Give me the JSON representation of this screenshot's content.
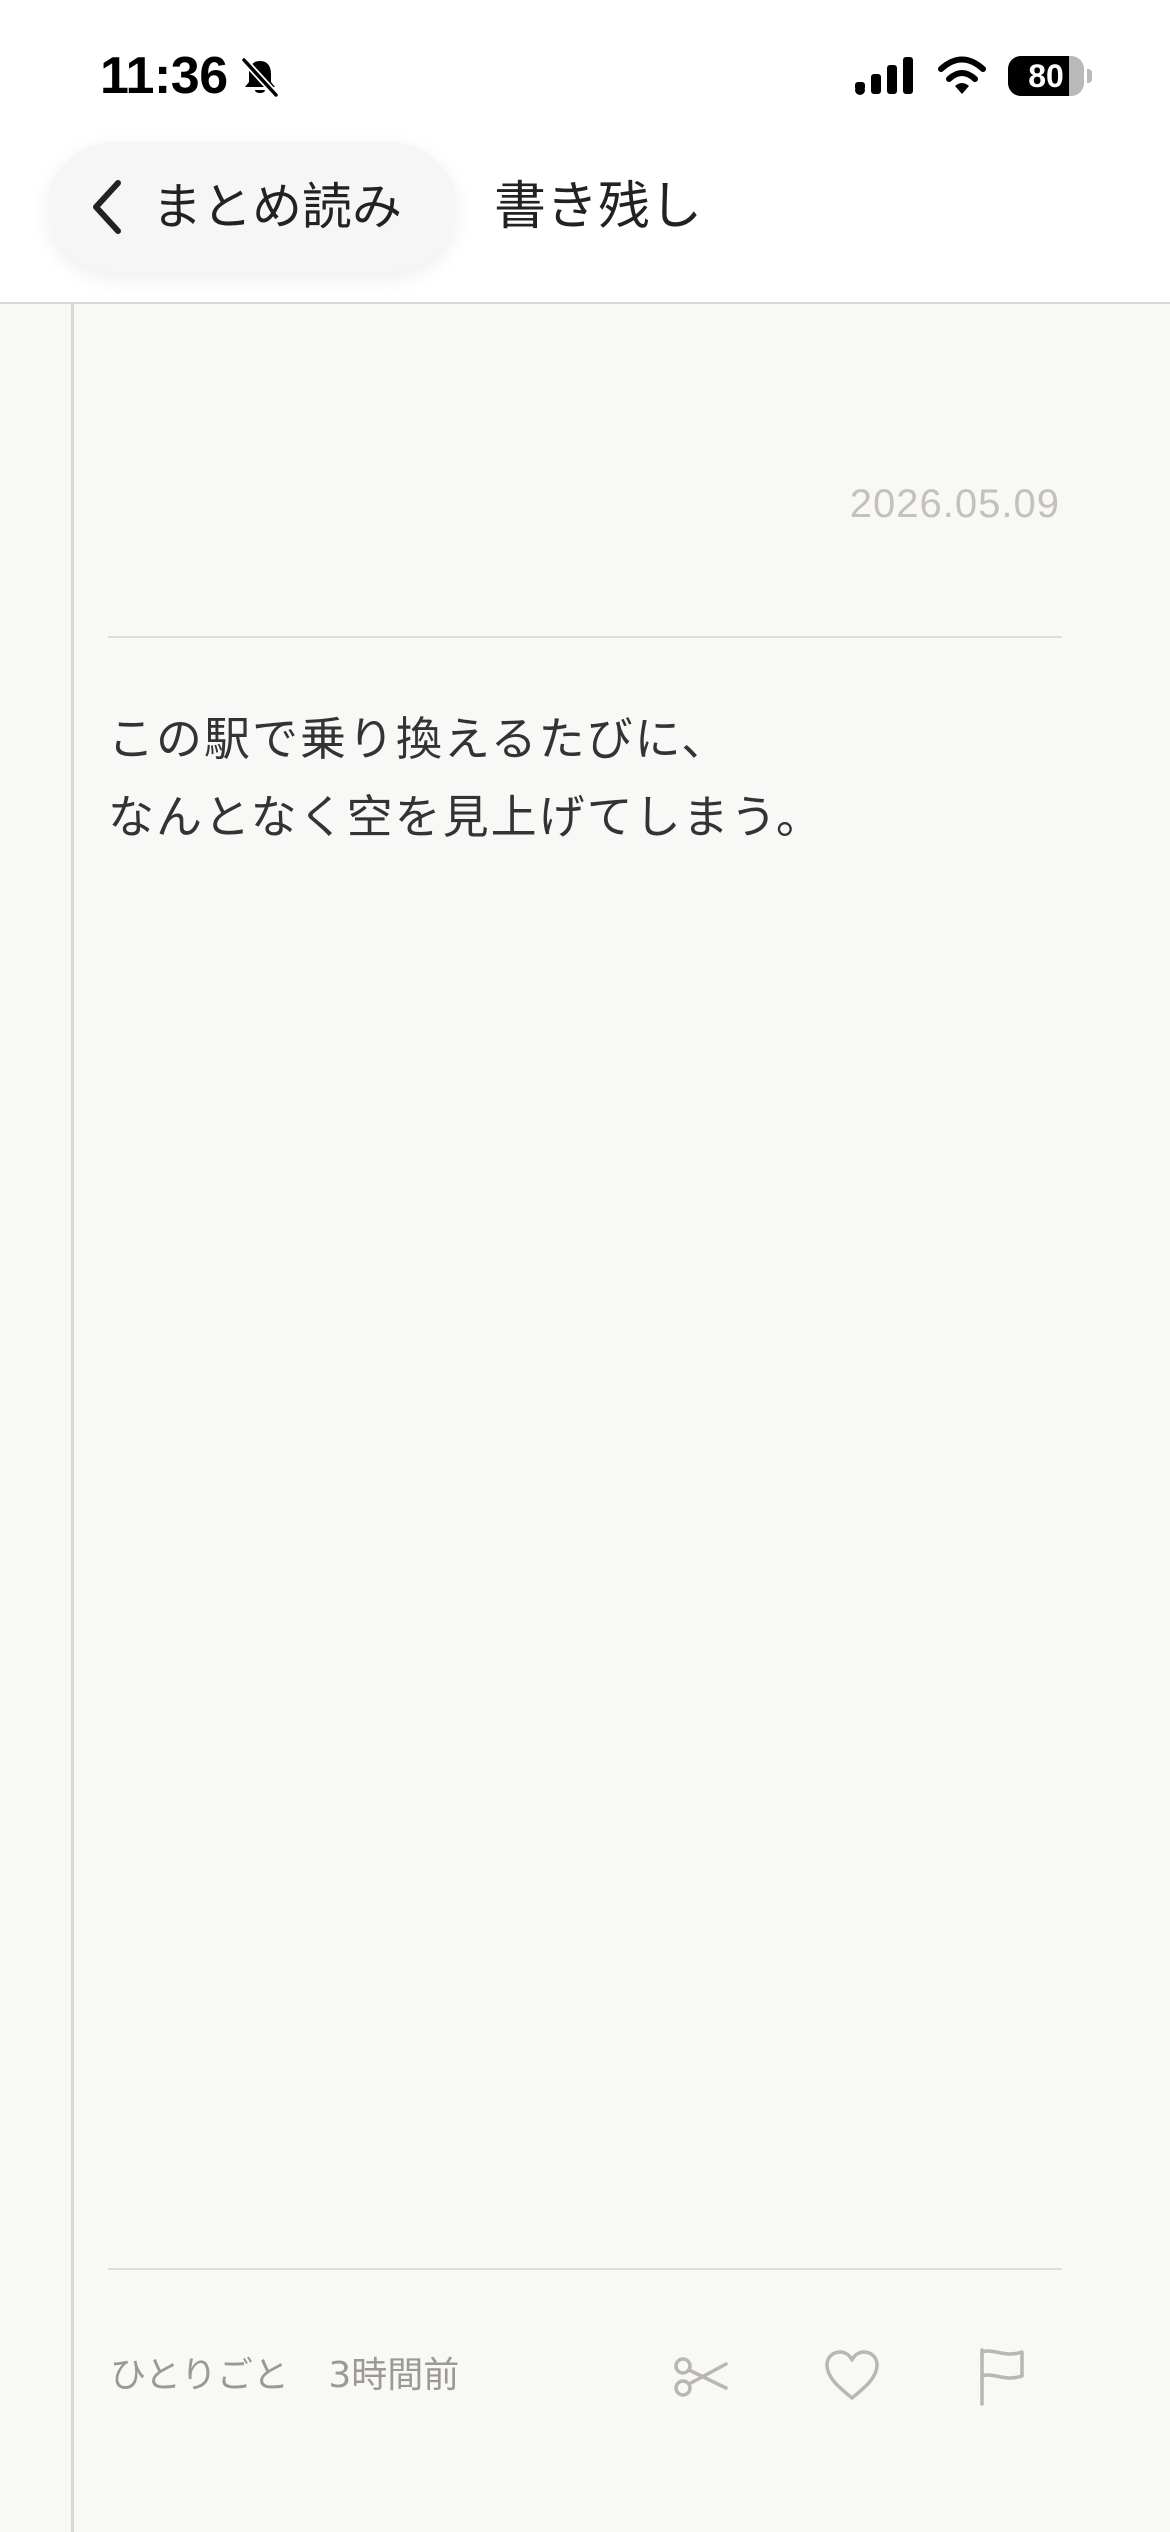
{
  "status_bar": {
    "time": "11:36",
    "battery_percent": "80",
    "battery_level": 0.8,
    "icons": [
      "bell-slash-icon",
      "signal-icon",
      "wifi-icon",
      "battery-icon"
    ]
  },
  "nav": {
    "back_label": "まとめ読み",
    "title": "書き残し"
  },
  "entry": {
    "date": "2026.05.09",
    "lines": [
      "この駅で乗り換えるたびに、",
      "なんとなく空を見上げてしまう。"
    ]
  },
  "footer": {
    "category": "ひとりごと",
    "time_ago": "3時間前",
    "actions": [
      "scissors-icon",
      "heart-icon",
      "flag-icon"
    ]
  },
  "colors": {
    "background": "#f8f8f7",
    "header_background": "#ffffff",
    "text": "#222222",
    "muted_text": "#9c9892",
    "date_text": "#c5c0b9",
    "icon_stroke": "#bab6b0",
    "divider": "#dcdcda"
  }
}
